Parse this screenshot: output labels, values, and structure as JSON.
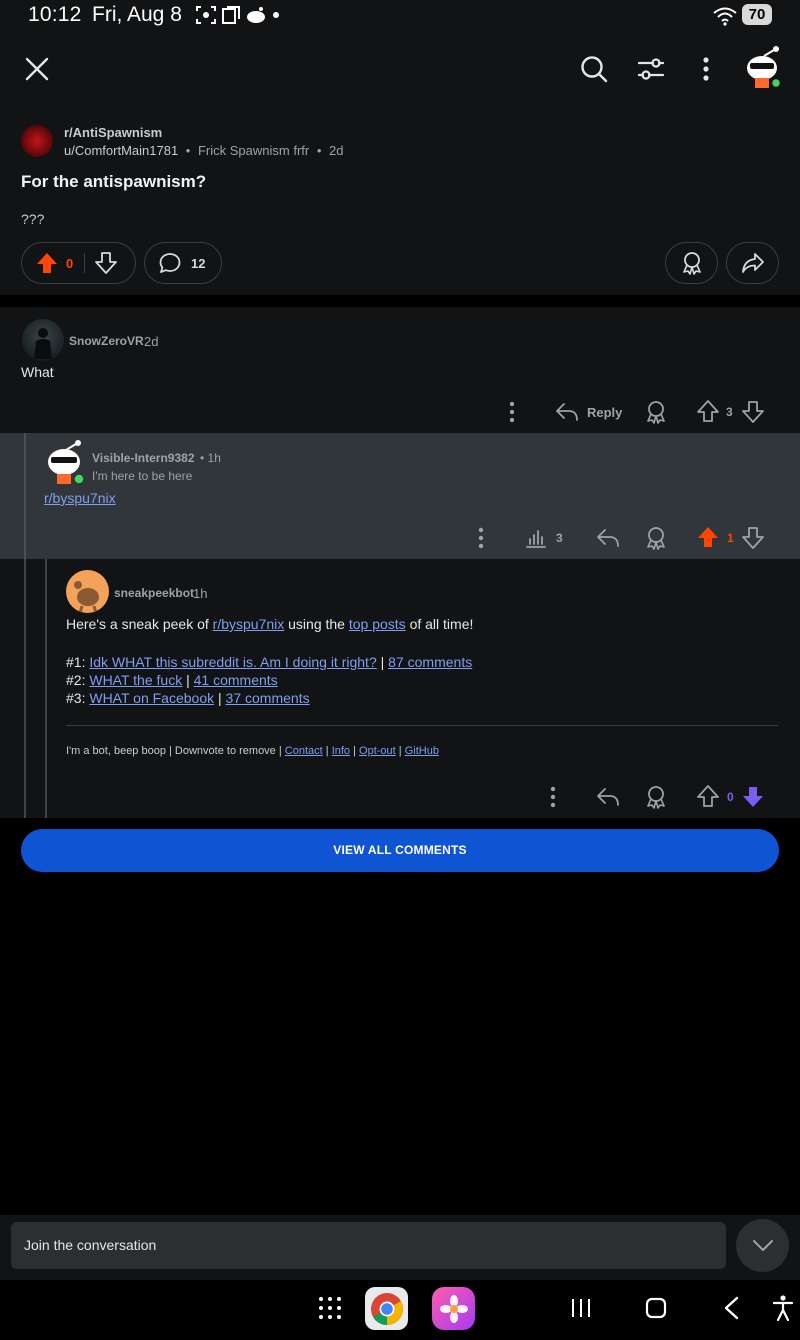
{
  "status_bar": {
    "time": "10:12",
    "date": "Fri, Aug 8",
    "battery": "70"
  },
  "post": {
    "subreddit": "r/AntiSpawnism",
    "author": "u/ComfortMain1781",
    "flair": "Frick Spawnism frfr",
    "age": "2d",
    "meta_sep": "•",
    "title": "For the antispawnism?",
    "body": "???",
    "score": "0",
    "comment_count": "12"
  },
  "comments": [
    {
      "author": "SnowZeroVR",
      "age": "2d",
      "text": "What",
      "reply_label": "Reply",
      "score": "3"
    },
    {
      "author": "Visible-Intern9382",
      "age_text": "• 1h",
      "flair": "I'm here to be here",
      "link_text": "r/byspu7nix",
      "views": "3",
      "score": "1"
    },
    {
      "author": "sneakpeekbot",
      "age": "1h",
      "intro_pre": "Here's a sneak peek of ",
      "intro_link": "r/byspu7nix",
      "intro_mid": " using the ",
      "intro_link2": "top posts",
      "intro_post": " of all time!",
      "posts": [
        {
          "num": "#1: ",
          "title": "Idk WHAT this subreddit is. Am I doing it right?",
          "sep": " | ",
          "comments": "87 comments"
        },
        {
          "num": "#2: ",
          "title": "WHAT the fuck",
          "sep": " | ",
          "comments": "41 comments"
        },
        {
          "num": "#3: ",
          "title": "WHAT on Facebook",
          "sep": " | ",
          "comments": "37 comments"
        }
      ],
      "footer_pre": "I'm a bot, beep boop | Downvote to remove | ",
      "footer_links": [
        "Contact",
        "Info",
        "Opt-out",
        "GitHub"
      ],
      "footer_sep": " | ",
      "score": "0"
    }
  ],
  "view_all_label": "VIEW ALL COMMENTS",
  "composer": {
    "placeholder": "Join the conversation"
  },
  "icons": {
    "close": "close-icon",
    "search": "search-icon",
    "filter": "filter-icon",
    "more": "more-vertical-icon",
    "upvote": "upvote-icon",
    "downvote": "downvote-icon",
    "comment": "comment-icon",
    "award": "award-icon",
    "share": "share-icon",
    "reply": "reply-icon",
    "views": "bar-chart-icon"
  },
  "colors": {
    "accent_orange": "#ff4500",
    "accent_blue": "#0f55d3",
    "link": "#7e9ff2",
    "downvote_purple": "#7d5cf0"
  }
}
